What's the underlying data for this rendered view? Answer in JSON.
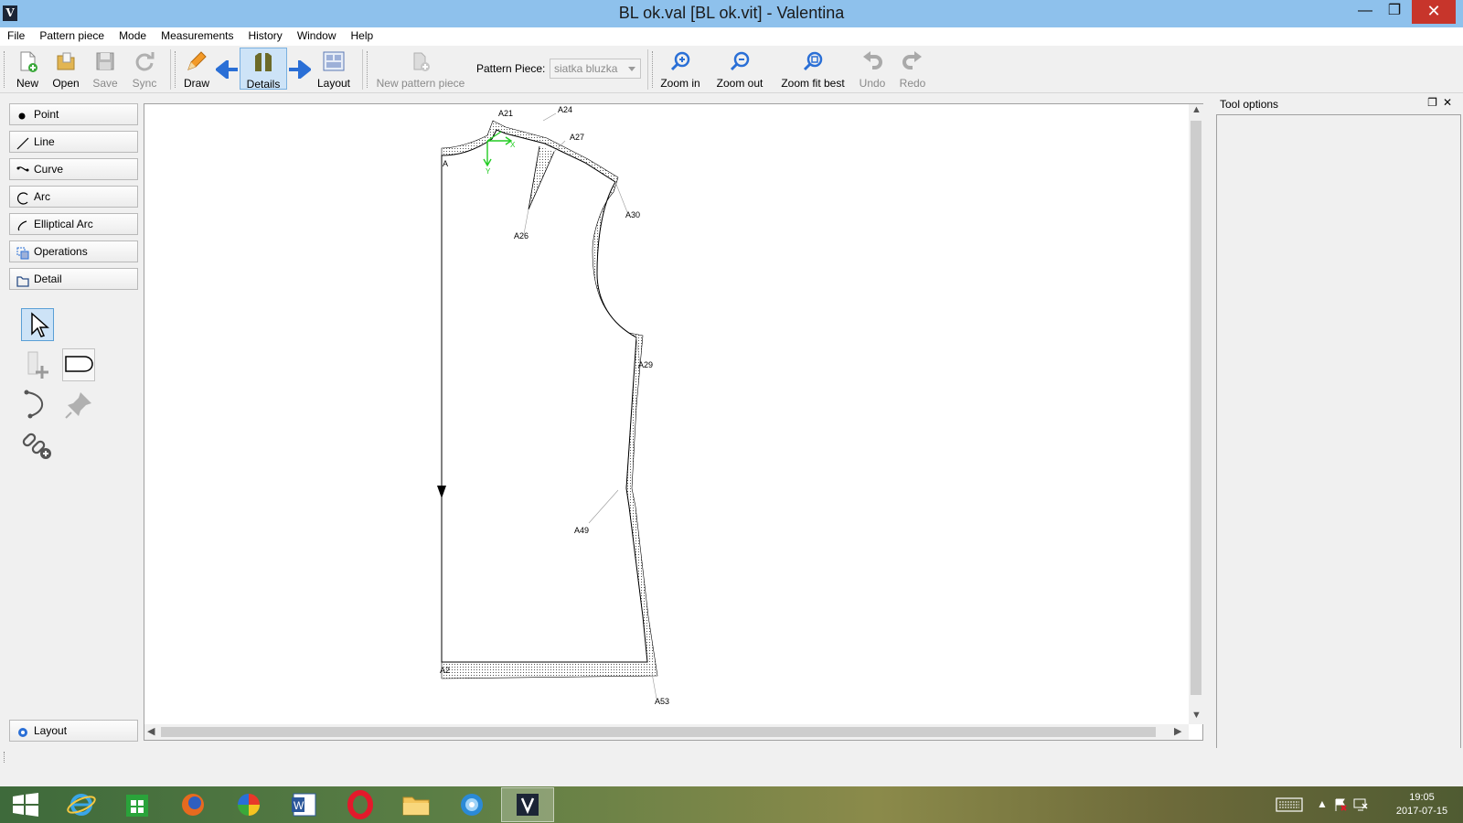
{
  "window": {
    "title": "BL ok.val [BL ok.vit] - Valentina",
    "app_icon_glyph": "V",
    "minimize_glyph": "—",
    "maximize_glyph": "❐",
    "close_glyph": "✕"
  },
  "menu": [
    "File",
    "Pattern piece",
    "Mode",
    "Measurements",
    "History",
    "Window",
    "Help"
  ],
  "toolbar": {
    "new": "New",
    "open": "Open",
    "save": "Save",
    "sync": "Sync",
    "draw": "Draw",
    "details": "Details",
    "layout": "Layout",
    "new_pattern_piece": "New pattern piece",
    "pattern_piece_label": "Pattern Piece:",
    "pattern_piece_value": "siatka bluzka",
    "zoom_in": "Zoom in",
    "zoom_out": "Zoom out",
    "zoom_fit_best": "Zoom fit best",
    "undo": "Undo",
    "redo": "Redo"
  },
  "tools": {
    "groups": [
      "Point",
      "Line",
      "Curve",
      "Arc",
      "Elliptical Arc",
      "Operations",
      "Detail"
    ],
    "bottom_group": "Layout"
  },
  "drawing": {
    "points": [
      "A21",
      "A24",
      "A27",
      "A",
      "A30",
      "A26",
      "A29",
      "A49",
      "A2",
      "A53"
    ],
    "axis_x": "X",
    "axis_y": "Y"
  },
  "dock": {
    "title": "Tool options"
  },
  "taskbar": {
    "time": "19:05",
    "date": "2017-07-15"
  },
  "colors": {
    "titlebar": "#8ec1ec",
    "close": "#c7352b",
    "active_tool": "#cde3f7",
    "accent_blue": "#2a6fd6",
    "axis_green": "#22cc22"
  }
}
